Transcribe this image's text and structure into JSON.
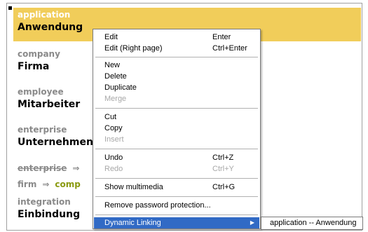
{
  "entries": [
    {
      "term": "application",
      "translation": "Anwendung",
      "selected": true
    },
    {
      "term": "company",
      "translation": "Firma"
    },
    {
      "term": "employee",
      "translation": "Mitarbeiter"
    },
    {
      "term": "enterprise",
      "translation": "Unternehmen"
    },
    {
      "term": "integration",
      "translation": "Einbindung"
    }
  ],
  "links": [
    {
      "source": "enterprise",
      "arrow": "⇒",
      "target": "",
      "strikethrough": true
    },
    {
      "source": "firm",
      "arrow": "⇒",
      "target": "comp"
    }
  ],
  "context_menu": {
    "items": [
      {
        "label": "Edit",
        "shortcut": "Enter"
      },
      {
        "label": "Edit (Right page)",
        "shortcut": "Ctrl+Enter"
      },
      {
        "label": "New"
      },
      {
        "label": "Delete"
      },
      {
        "label": "Duplicate"
      },
      {
        "label": "Merge",
        "disabled": true
      },
      {
        "label": "Cut"
      },
      {
        "label": "Copy"
      },
      {
        "label": "Insert",
        "disabled": true
      },
      {
        "label": "Undo",
        "shortcut": "Ctrl+Z"
      },
      {
        "label": "Redo",
        "shortcut": "Ctrl+Y",
        "disabled": true
      },
      {
        "label": "Show multimedia",
        "shortcut": "Ctrl+G"
      },
      {
        "label": "Remove password protection..."
      },
      {
        "label": "Dynamic Linking",
        "has_submenu": true,
        "active": true
      }
    ],
    "submenu_arrow": "▶",
    "submenu": {
      "item": "application -- Anwendung"
    }
  },
  "colors": {
    "selection_highlight": "#f1cd5a",
    "menu_active": "#316ac5",
    "link_target": "#8a9a10"
  }
}
